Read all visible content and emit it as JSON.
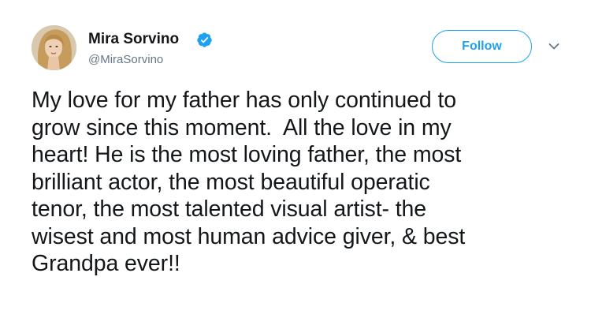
{
  "tweet": {
    "author": {
      "display_name": "Mira Sorvino",
      "handle": "@MiraSorvino",
      "verified": true,
      "avatar_icon": "profile-photo"
    },
    "follow_label": "Follow",
    "menu_icon": "chevron-down-icon",
    "text_lines": [
      "My love for my father has only continued to",
      "grow since this moment.  All the love in my",
      "heart! He is the most loving father, the most",
      "brilliant actor, the most beautiful operatic",
      "tenor, the most talented visual artist- the",
      "wisest and most human advice giver, & best",
      "Grandpa ever!!"
    ]
  },
  "colors": {
    "accent": "#1da1f2",
    "text": "#14171a",
    "secondary_text": "#657786",
    "chevron": "#657786"
  }
}
